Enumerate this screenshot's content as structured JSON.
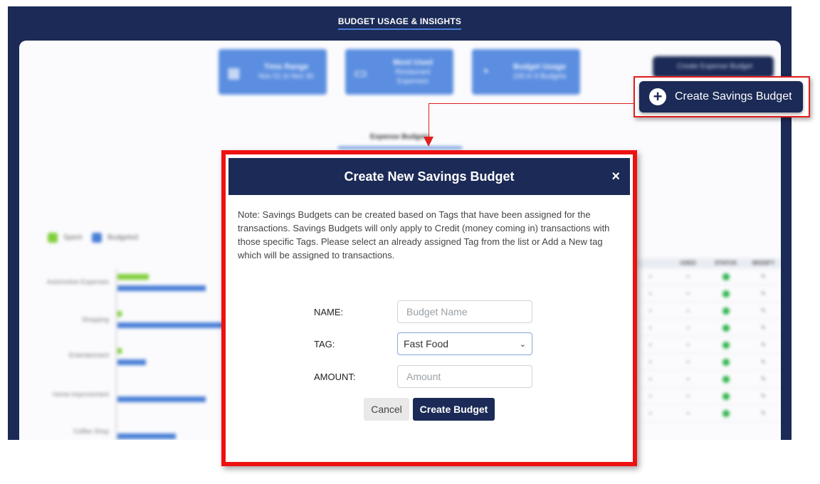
{
  "app": {
    "title": "BUDGET USAGE & INSIGHTS"
  },
  "cards": [
    {
      "title": "Time Range",
      "subtitle": "Nov 01 to Nov 30",
      "icon": "calendar-icon"
    },
    {
      "title": "Most Used",
      "subtitle": "Restaurant Expenses",
      "icon": "wallet-icon"
    },
    {
      "title": "Budget Usage",
      "subtitle": "100 in 9 Budgets",
      "icon": "pie-chart-icon"
    }
  ],
  "create_expense_label": "Create Expense Budget",
  "tab_label": "Expense Budgets",
  "legend": {
    "spent": "Spent",
    "budgeted": "Budgeted"
  },
  "background_categories": [
    "Automotive Expenses",
    "Shopping",
    "Entertainment",
    "Home Improvement",
    "Coffee Shop"
  ],
  "table_headers": [
    "",
    "USED",
    "STATUS",
    "MODIFY"
  ],
  "callout": {
    "label": "Create Savings Budget",
    "icon": "plus-circle-icon"
  },
  "modal": {
    "title": "Create New Savings Budget",
    "close": "×",
    "note": "Note: Savings Budgets can be created based on Tags that have been assigned for the transactions. Savings Budgets will only apply to Credit (money coming in) transactions with those specific Tags. Please select an already assigned Tag from the list or Add a New tag which will be assigned to transactions.",
    "name_label": "NAME:",
    "name_placeholder": "Budget Name",
    "tag_label": "TAG:",
    "tag_value": "Fast Food",
    "amount_label": "AMOUNT:",
    "amount_placeholder": "Amount",
    "cancel_label": "Cancel",
    "create_label": "Create Budget"
  },
  "colors": {
    "navy": "#1b2a56",
    "accent": "#4a7fd6",
    "highlight": "#ee1111",
    "spent": "#7fcf3a"
  }
}
